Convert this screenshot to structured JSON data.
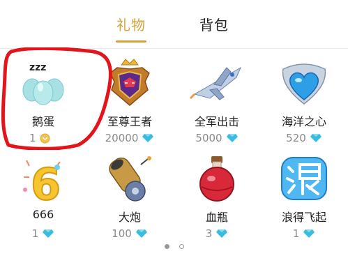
{
  "tabs": [
    {
      "label": "礼物",
      "active": true
    },
    {
      "label": "背包",
      "active": false
    }
  ],
  "gifts": [
    {
      "name": "鹅蛋",
      "price": "1",
      "currency": "coin",
      "icon": "goose-egg-icon"
    },
    {
      "name": "至尊王者",
      "price": "20000",
      "currency": "diamond",
      "icon": "king-emblem-icon"
    },
    {
      "name": "全军出击",
      "price": "5000",
      "currency": "diamond",
      "icon": "fighter-jet-icon"
    },
    {
      "name": "海洋之心",
      "price": "520",
      "currency": "diamond",
      "icon": "ocean-heart-icon"
    },
    {
      "name": "666",
      "price": "1",
      "currency": "diamond",
      "icon": "number-six-icon"
    },
    {
      "name": "大炮",
      "price": "100",
      "currency": "diamond",
      "icon": "cannon-icon"
    },
    {
      "name": "血瓶",
      "price": "3",
      "currency": "diamond",
      "icon": "potion-bottle-icon"
    },
    {
      "name": "浪得飞起",
      "price": "1",
      "currency": "diamond",
      "icon": "lang-character-icon"
    }
  ],
  "pagination": {
    "pages": 2,
    "current": 1
  },
  "colors": {
    "accent": "#d4a33a",
    "diamond": "#38bde0",
    "highlight": "#e4141b"
  }
}
